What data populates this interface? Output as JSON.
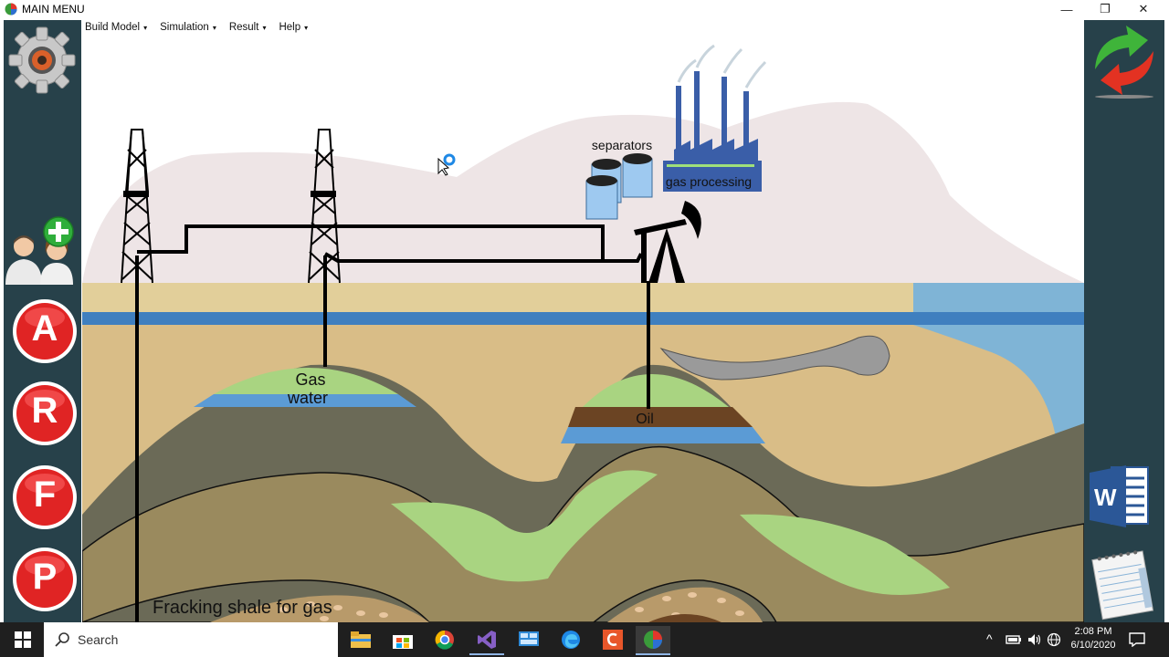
{
  "window": {
    "title": "MAIN MENU",
    "minimize": "—",
    "restore": "❐",
    "close": "✕"
  },
  "menu": [
    {
      "label": "Build Model",
      "caret": "▾"
    },
    {
      "label": "Simulation",
      "caret": "▾"
    },
    {
      "label": "Result",
      "caret": "▾"
    },
    {
      "label": "Help",
      "caret": "▾"
    }
  ],
  "left_panel": {
    "buttons": [
      {
        "letter": "A"
      },
      {
        "letter": "R"
      },
      {
        "letter": "F"
      },
      {
        "letter": "P"
      }
    ],
    "icons": [
      "gear-icon",
      "add-users-icon"
    ]
  },
  "right_panel": {
    "icons": [
      "refresh-arrows-icon",
      "word-icon",
      "notepad-icon"
    ],
    "word_letter": "W"
  },
  "scene": {
    "labels": {
      "separators": "separators",
      "gas_processing": "gas processing",
      "gas": "Gas",
      "water": "water",
      "oil": "Oil",
      "fracking": "Fracking shale for gas"
    },
    "colors": {
      "sky": "#ffffff",
      "mountain": "#efe6e6",
      "ground_top": "#e2cf9a",
      "water": "#3f7fbf",
      "sand": "#d9bd87",
      "dark_layer": "#6b6a57",
      "mid_layer": "#9a8a5e",
      "green": "#a9d481",
      "oil": "#6b4423",
      "sea": "#7fb4d6",
      "factory": "#3a5ea8",
      "tank": "#9ec9f0",
      "smoke": "#9a9a9a"
    }
  },
  "taskbar": {
    "search_label": "Search",
    "time": "2:08 PM",
    "date": "6/10/2020",
    "apps": [
      "windows-start-icon",
      "file-explorer-icon",
      "store-icon",
      "chrome-icon",
      "visual-studio-icon",
      "control-panel-icon",
      "edge-icon",
      "app-c-icon",
      "pie-chart-app-icon"
    ]
  }
}
